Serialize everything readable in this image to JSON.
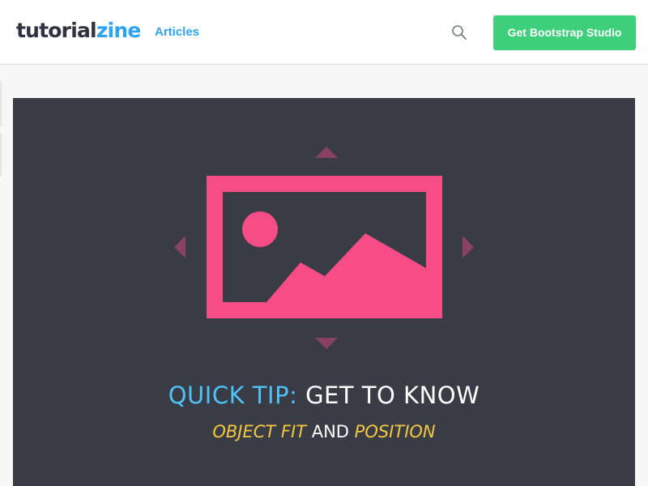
{
  "header": {
    "logo": {
      "part1": "tutorial",
      "part2": "zine"
    },
    "nav": {
      "articles": "Articles"
    },
    "search": {
      "icon": "search-icon"
    },
    "cta": {
      "label": "Get Bootstrap Studio"
    }
  },
  "hero": {
    "title": {
      "highlight": "QUICK TIP:",
      "rest": "GET TO KNOW"
    },
    "subtitle": {
      "part1": "OBJECT FIT",
      "part2": "AND",
      "part3": "POSITION"
    },
    "illustration": {
      "icon": "image-icon"
    }
  },
  "colors": {
    "accent_blue": "#2ea3f2",
    "cta_green": "#3ecf7b",
    "hero_bg": "#393b45",
    "image_pink": "#f64d86",
    "arrow_mauve": "#8a4061",
    "title_blue": "#4fc2f7",
    "subtitle_yellow": "#f5c842"
  }
}
